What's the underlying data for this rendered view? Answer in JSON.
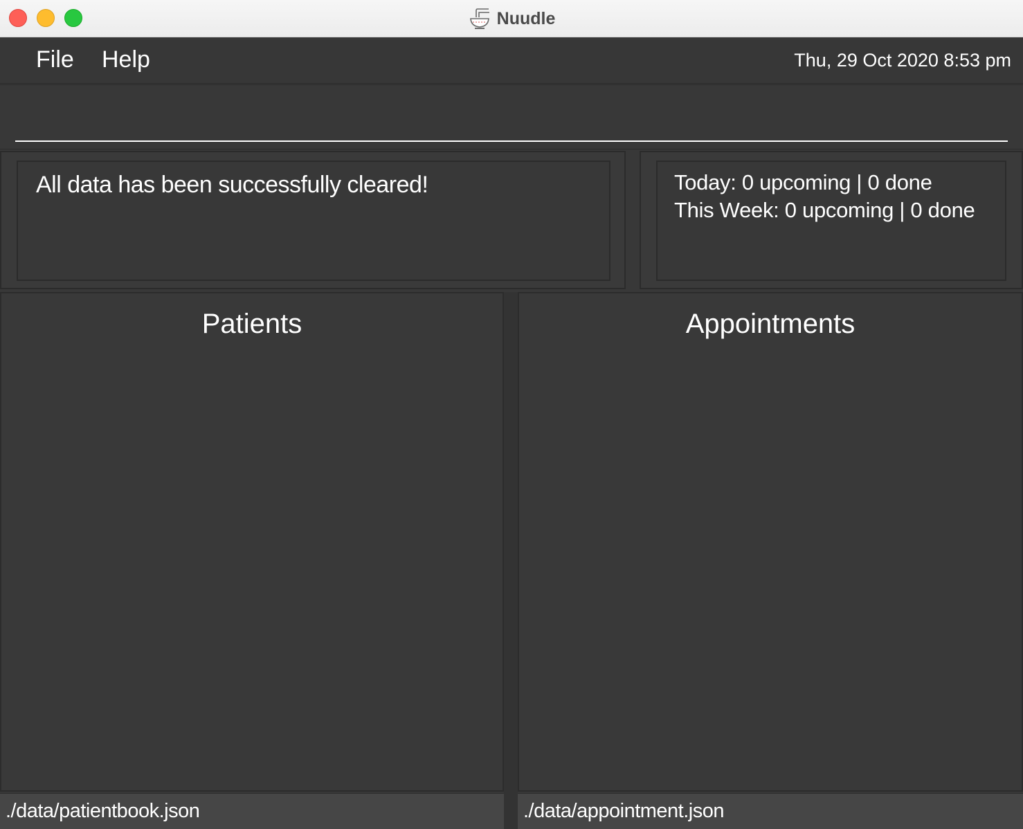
{
  "window": {
    "title": "Nuudle",
    "app_icon": "noodle-bowl-icon"
  },
  "menu": {
    "file_label": "File",
    "help_label": "Help"
  },
  "clock": {
    "datetime": "Thu, 29 Oct 2020 8:53 pm"
  },
  "command": {
    "value": "",
    "placeholder": ""
  },
  "result": {
    "message": "All data has been successfully cleared!"
  },
  "stats": {
    "today": "Today: 0 upcoming | 0 done",
    "this_week": "This Week: 0 upcoming | 0 done"
  },
  "patients": {
    "title": "Patients",
    "items": [],
    "storage_path": "./data/patientbook.json"
  },
  "appointments": {
    "title": "Appointments",
    "items": [],
    "storage_path": "./data/appointment.json"
  },
  "colors": {
    "background": "#383838",
    "text": "#ffffff",
    "close": "#fe5f57",
    "minimize": "#febc2e",
    "zoom": "#28c840"
  }
}
